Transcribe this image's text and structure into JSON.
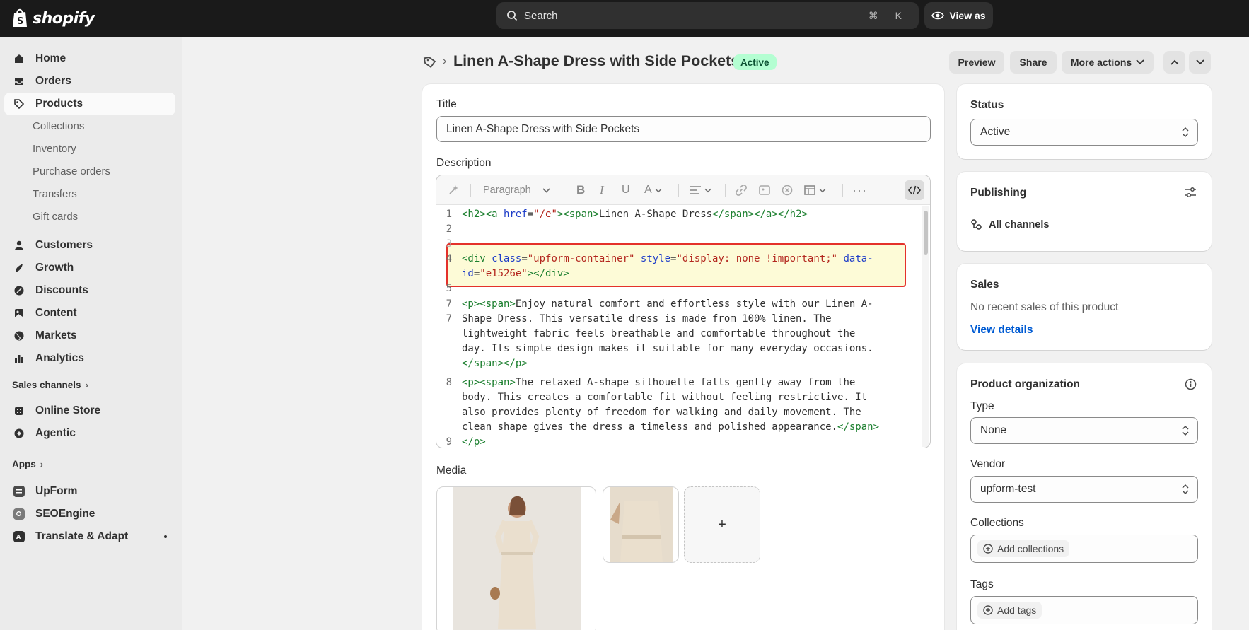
{
  "topbar": {
    "logo_text": "shopify",
    "search_placeholder": "Search",
    "search_shortcut": "⌘ K",
    "view_as_label": "View as"
  },
  "sidebar": {
    "home": "Home",
    "orders": "Orders",
    "products": "Products",
    "products_sub": [
      "Collections",
      "Inventory",
      "Purchase orders",
      "Transfers",
      "Gift cards"
    ],
    "customers": "Customers",
    "growth": "Growth",
    "discounts": "Discounts",
    "content": "Content",
    "markets": "Markets",
    "analytics": "Analytics",
    "sales_channels_label": "Sales channels",
    "online_store": "Online Store",
    "agentic": "Agentic",
    "apps_label": "Apps",
    "apps": [
      "UpForm",
      "SEOEngine",
      "Translate & Adapt"
    ]
  },
  "header": {
    "title": "Linen A-Shape Dress with Side Pockets",
    "status_badge": "Active",
    "preview": "Preview",
    "share": "Share",
    "more_actions": "More actions"
  },
  "main": {
    "title_label": "Title",
    "title_value": "Linen A-Shape Dress with Side Pockets",
    "description_label": "Description",
    "toolbar_paragraph": "Paragraph",
    "gutter": [
      "1",
      "2",
      "3",
      "4",
      "5",
      "7",
      "7",
      "8",
      "9"
    ],
    "code": {
      "l1_a": "<h2><a ",
      "l1_b": "href",
      "l1_c": "=",
      "l1_d": "\"/e\"",
      "l1_e": "><span>",
      "l1_f": "Linen A-Shape Dress",
      "l1_g": "</span></a></h2>",
      "l4_a": "<div ",
      "l4_b": "class",
      "l4_c": "=",
      "l4_d": "\"upform-container\"",
      "l4_e": " style",
      "l4_f": "=",
      "l4_g": "\"display: none !important;\"",
      "l4_h": " data-",
      "l4b_a": "id",
      "l4b_b": "=",
      "l4b_c": "\"e1526e\"",
      "l4b_d": "></div>",
      "p1_a": "<p><span>",
      "p1_b": "Enjoy natural comfort and effortless style with our Linen A-",
      "p1_2": "Shape Dress. This versatile dress is made from 100% linen. The",
      "p1_3": "lightweight fabric feels breathable and comfortable throughout the",
      "p1_4": "day. Its simple design makes it suitable for many everyday occasions.",
      "p1_5": "</span></p>",
      "p2_a": "<p><span>",
      "p2_b": "The relaxed A-shape silhouette falls gently away from the",
      "p2_2": "body. This creates a comfortable fit without feeling restrictive. It",
      "p2_3": "also provides plenty of freedom for walking and daily movement. The",
      "p2_4a": "clean shape gives the dress a timeless and polished appearance.",
      "p2_4b": "</span>",
      "p2_5": "</p>"
    },
    "media_label": "Media",
    "media_add": "+"
  },
  "right": {
    "status_label": "Status",
    "status_value": "Active",
    "publishing_label": "Publishing",
    "all_channels": "All channels",
    "sales_label": "Sales",
    "no_sales": "No recent sales of this product",
    "view_details": "View details",
    "org_label": "Product organization",
    "type_label": "Type",
    "type_value": "None",
    "vendor_label": "Vendor",
    "vendor_value": "upform-test",
    "collections_label": "Collections",
    "add_collections": "Add collections",
    "tags_label": "Tags",
    "add_tags": "Add tags"
  },
  "colors": {
    "highlight_border": "#e4312b",
    "highlight_bg": "#fdfbd7",
    "badge_bg": "#b4fed2",
    "link": "#005bd3"
  }
}
